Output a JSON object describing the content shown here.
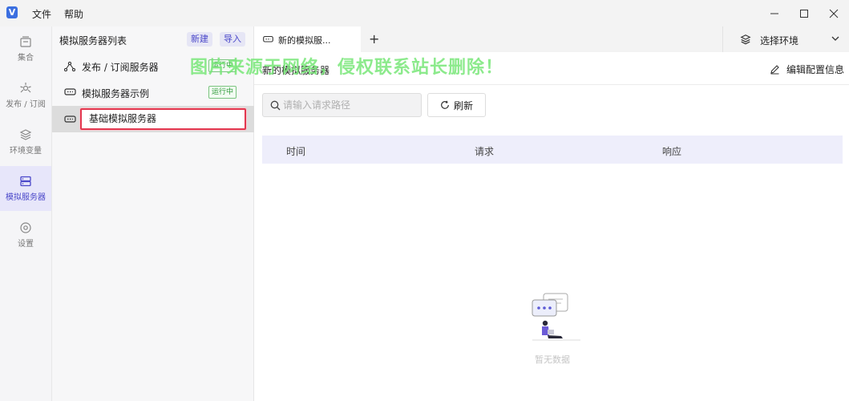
{
  "app": {
    "logo_letter": "V",
    "menu": [
      "文件",
      "帮助"
    ]
  },
  "rail": [
    {
      "label": "集合",
      "icon": "collection-icon",
      "active": false
    },
    {
      "label": "发布 / 订阅",
      "icon": "pubsub-icon",
      "active": false
    },
    {
      "label": "环境变量",
      "icon": "layers-icon",
      "active": false
    },
    {
      "label": "模拟服务器",
      "icon": "server-icon",
      "active": true
    },
    {
      "label": "设置",
      "icon": "settings-icon",
      "active": false
    }
  ],
  "server_panel": {
    "title": "模拟服务器列表",
    "new_label": "新建",
    "import_label": "导入",
    "items": [
      {
        "label": "发布 / 订阅服务器",
        "icon": "pubsub-icon",
        "status": "运行中"
      },
      {
        "label": "模拟服务器示例",
        "icon": "server-icon",
        "status": "运行中"
      }
    ],
    "editing_value": "基础模拟服务器"
  },
  "tabs": [
    {
      "label": "新的模拟服..."
    }
  ],
  "add_tab": "+",
  "env_select": {
    "label": "选择环境"
  },
  "main": {
    "title": "新的模拟服务器",
    "edit_config_label": "编辑配置信息",
    "search_placeholder": "请输入请求路径",
    "refresh_label": "刷新",
    "columns": [
      "时间",
      "请求",
      "响应"
    ],
    "empty_text": "暂无数据"
  },
  "watermark": "图片来源于网络，侵权联系站长删除！",
  "colors": {
    "accent": "#4a47c9",
    "status_green": "#2f9b3a",
    "selection_border": "#e2374f",
    "watermark": "#78e678"
  }
}
